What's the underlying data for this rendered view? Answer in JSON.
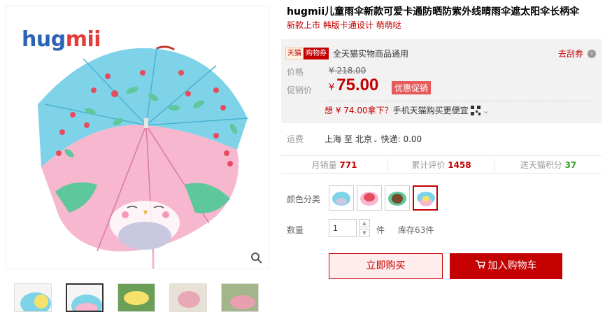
{
  "brand": {
    "part1": "hug",
    "part2": "mii"
  },
  "product": {
    "title": "hugmii儿童雨伞新款可爱卡通防晒防紫外线晴雨伞遮太阳伞长柄伞",
    "subtitle": "新款上市 韩版卡通设计 萌萌哒"
  },
  "promo": {
    "tag1": "天猫",
    "tag2": "购物券",
    "text": "全天猫实物商品通用",
    "coupon_link": "去刮券",
    "coupon_arrow": "›"
  },
  "price": {
    "label_price": "价格",
    "original": "¥ 218.00",
    "label_promo": "促销价",
    "currency": "¥",
    "promo_value": "75.00",
    "promo_tag": "优惠促销",
    "mobile_prefix": "想 ¥ 74.00拿下？",
    "mobile_suffix": "手机天猫购买更便宜",
    "mobile_dropdown": "⌄"
  },
  "shipping": {
    "label": "运费",
    "from": "上海",
    "to_word": "至",
    "to_city": "北京",
    "dropdown": "⌄",
    "express": "快递: 0.00"
  },
  "stats": {
    "monthly_label": "月销量",
    "monthly_value": "771",
    "reviews_label": "累计评价",
    "reviews_value": "1458",
    "points_label": "送天猫积分",
    "points_value": "37"
  },
  "color": {
    "label": "颜色分类",
    "selected_index": 3,
    "swatches": [
      "blue-grey",
      "pink-red",
      "brown-green",
      "blue-pink"
    ]
  },
  "quantity": {
    "label": "数量",
    "value": "1",
    "up": "▲",
    "down": "▼",
    "unit": "件",
    "stock": "库存63件"
  },
  "buttons": {
    "buy_now": "立即购买",
    "add_cart": "加入购物车"
  },
  "colors": {
    "accent": "#c40000",
    "umbrella_blue": "#7fd3e8",
    "umbrella_pink": "#f6b7cf",
    "leaf_green": "#5fc79c"
  },
  "icons": {
    "zoom": "magnifier-icon",
    "cart": "cart-icon",
    "qr": "qr-code-icon"
  }
}
